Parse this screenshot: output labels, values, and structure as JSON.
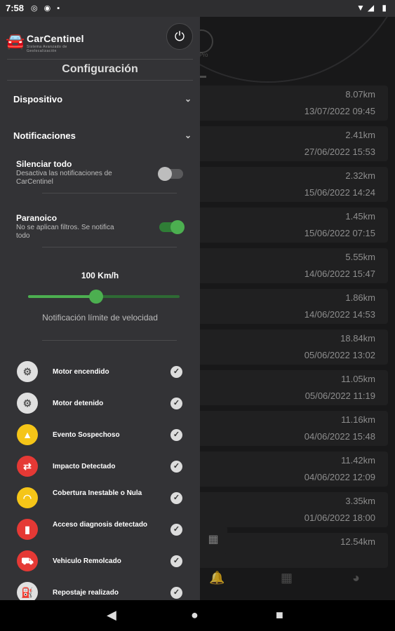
{
  "status_bar": {
    "time": "7:58",
    "left_icons": "◎ ◉ ▪",
    "right_icons": "▼◢ ▮"
  },
  "drawer": {
    "logo": {
      "brand": "CarCentinel",
      "tagline": "Sistema Avanzado de Geolocalización"
    },
    "power_button": "⏻",
    "title": "Configuración",
    "sections": {
      "device": "Dispositivo",
      "notifications": "Notificaciones"
    },
    "chevron": "⌄",
    "settings": [
      {
        "title": "Silenciar todo",
        "desc": "Desactiva las notificaciones de CarCentinel",
        "enabled": false
      },
      {
        "title": "Paranoico",
        "desc": "No se aplican filtros. Se notifica todo",
        "enabled": true
      }
    ],
    "speed": {
      "value_label": "100 Km/h",
      "caption": "Notificación límite de velocidad",
      "fraction": 0.45
    },
    "notifications": [
      {
        "label": "Motor encendido",
        "icon": "engine-on-icon",
        "glyph": "⚙",
        "color": "#e0e0e0",
        "fg": "#555"
      },
      {
        "label": "Motor detenido",
        "icon": "engine-off-icon",
        "glyph": "⚙",
        "color": "#e0e0e0",
        "fg": "#555"
      },
      {
        "label": "Evento Sospechoso",
        "icon": "warning-icon",
        "glyph": "▲",
        "color": "#f5c518",
        "fg": "#fff"
      },
      {
        "label": "Impacto Detectado",
        "icon": "impact-icon",
        "glyph": "⇄",
        "color": "#e53935",
        "fg": "#fff"
      },
      {
        "label": "Cobertura Inestable o Nula",
        "icon": "signal-icon",
        "glyph": "◠",
        "color": "#f5c518",
        "fg": "#fff"
      },
      {
        "label": "Acceso diagnosis detectado",
        "icon": "diagnosis-icon",
        "glyph": "▮",
        "color": "#e53935",
        "fg": "#fff"
      },
      {
        "label": "Vehiculo Remolcado",
        "icon": "tow-icon",
        "glyph": "⛟",
        "color": "#e53935",
        "fg": "#fff"
      },
      {
        "label": "Repostaje realizado",
        "icon": "fuel-icon",
        "glyph": "⛽",
        "color": "#e0e0e0",
        "fg": "#555"
      }
    ],
    "check_glyph": "✓"
  },
  "background": {
    "pro_text": "Pro",
    "trips": [
      {
        "km": "8.07km",
        "date": "13/07/2022 09:45"
      },
      {
        "km": "2.41km",
        "date": "27/06/2022 15:53"
      },
      {
        "km": "2.32km",
        "date": "15/06/2022 14:24"
      },
      {
        "km": "1.45km",
        "date": "15/06/2022 07:15"
      },
      {
        "km": "5.55km",
        "date": "14/06/2022 15:47"
      },
      {
        "km": "1.86km",
        "date": "14/06/2022 14:53"
      },
      {
        "km": "18.84km",
        "date": "05/06/2022 13:02"
      },
      {
        "km": "11.05km",
        "date": "05/06/2022 11:19"
      },
      {
        "km": "11.16km",
        "date": "04/06/2022 15:48"
      },
      {
        "km": "11.42km",
        "date": "04/06/2022 12:09"
      },
      {
        "km": "3.35km",
        "date": "01/06/2022 18:00"
      },
      {
        "km": "12.54km",
        "date": ""
      }
    ],
    "calendar_glyph": "▦",
    "bottom_nav": {
      "bell": "🔔",
      "calendar": "▦",
      "chart": "◕"
    }
  },
  "nav_bar": {
    "back": "◀",
    "home": "●",
    "recents": "■"
  }
}
